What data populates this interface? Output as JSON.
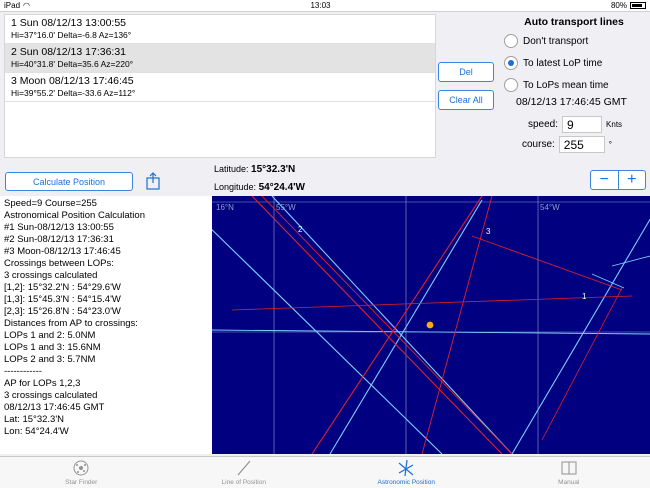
{
  "status": {
    "device": "iPad",
    "time": "13:03",
    "battery": "80%",
    "battery_level": 0.8
  },
  "sights": [
    {
      "title": "1 Sun 08/12/13 13:00:55",
      "detail": "Hi=37°16.0'  Delta=-6.8 Az=136°"
    },
    {
      "title": "2 Sun 08/12/13 17:36:31",
      "detail": "Hi=40°31.8'  Delta=35.6 Az=220°"
    },
    {
      "title": "3 Moon 08/12/13 17:46:45",
      "detail": "Hi=39°55.2'  Delta=-33.6 Az=112°"
    }
  ],
  "buttons": {
    "del": "Del",
    "clear_all": "Clear All",
    "calculate": "Calculate Position",
    "zoom_out": "−",
    "zoom_in": "+"
  },
  "transport": {
    "title": "Auto transport lines",
    "options": [
      "Don't  transport",
      "To latest LoP time",
      "To LoPs mean time"
    ],
    "selected": "To latest LoP time",
    "gmt": "08/12/13 17:46:45 GMT",
    "speed_label": "speed:",
    "speed_value": "9",
    "speed_unit": "Knts",
    "course_label": "course:",
    "course_value": "255",
    "course_unit": "°"
  },
  "position": {
    "lat_label": "Latitude:",
    "lat_value": "15°32.3'N",
    "lon_label": "Longitude:",
    "lon_value": "54°24.4'W"
  },
  "results": [
    "Speed=9  Course=255",
    "Astronomical Position Calculation",
    "#1 Sun-08/12/13 13:00:55",
    "#2 Sun-08/12/13 17:36:31",
    "#3 Moon-08/12/13 17:46:45",
    "Crossings between LOPs:",
    "3 crossings calculated",
    "[1,2]: 15°32.2'N : 54°29.6'W",
    "[1,3]: 15°45.3'N : 54°15.4'W",
    "[2,3]: 15°26.8'N : 54°23.0'W",
    "Distances from AP to crossings:",
    "LOPs 1 and 2:  5.0NM",
    "LOPs 1 and 3: 15.6NM",
    "LOPs 2 and 3:  5.7NM",
    "------------",
    "AP for LOPs 1,2,3",
    "3 crossings calculated",
    "08/12/13 17:46:45 GMT",
    "Lat: 15°32.3'N",
    "Lon: 54°24.4'W"
  ],
  "plot": {
    "label_lat": "16°N",
    "label_lon_left": "55°W",
    "label_lon_right": "54°W",
    "lop_labels": [
      "1",
      "2",
      "3"
    ]
  },
  "tabs": [
    {
      "label": "Star Finder",
      "icon": "star-finder-icon"
    },
    {
      "label": "Line of Position",
      "icon": "line-of-position-icon"
    },
    {
      "label": "Astronomic Position",
      "icon": "astronomic-position-icon",
      "active": true
    },
    {
      "label": "Manual",
      "icon": "manual-icon"
    }
  ],
  "colors": {
    "accent": "#1a6fd8",
    "plot_bg": "#000080",
    "lop_light": "#7fd0ff",
    "lop_red": "#e0202a",
    "ap_dot": "#ffaa00"
  }
}
